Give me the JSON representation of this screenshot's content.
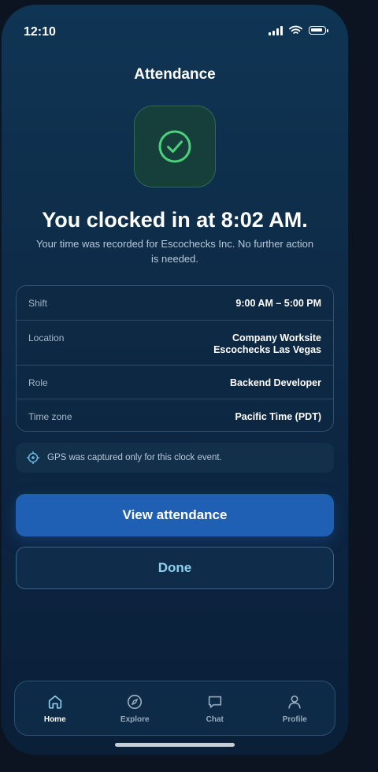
{
  "status_bar": {
    "time": "12:10"
  },
  "header": {
    "title": "Attendance"
  },
  "confirmation": {
    "headline": "You clocked in at 8:02 AM.",
    "message": "Your time was recorded for Escochecks Inc. No further action is needed."
  },
  "details": [
    {
      "label": "Shift",
      "value_lines": [
        "9:00 AM – 5:00 PM"
      ]
    },
    {
      "label": "Location",
      "value_lines": [
        "Company Worksite",
        "Escochecks Las Vegas"
      ]
    },
    {
      "label": "Role",
      "value_lines": [
        "Backend Developer"
      ]
    },
    {
      "label": "Time zone",
      "value_lines": [
        "Pacific Time (PDT)"
      ]
    }
  ],
  "gps_note": "GPS was captured only for this clock event.",
  "actions": {
    "primary_label": "View attendance",
    "secondary_label": "Done"
  },
  "tabbar": {
    "items": [
      {
        "label": "Home",
        "icon": "home-icon",
        "active": true
      },
      {
        "label": "Explore",
        "icon": "compass-icon",
        "active": false
      },
      {
        "label": "Chat",
        "icon": "chat-icon",
        "active": false
      },
      {
        "label": "Profile",
        "icon": "person-icon",
        "active": false
      }
    ]
  },
  "colors": {
    "accent": "#2060b4",
    "success": "#4ad17a",
    "secondary_text": "#8fd0ee"
  }
}
